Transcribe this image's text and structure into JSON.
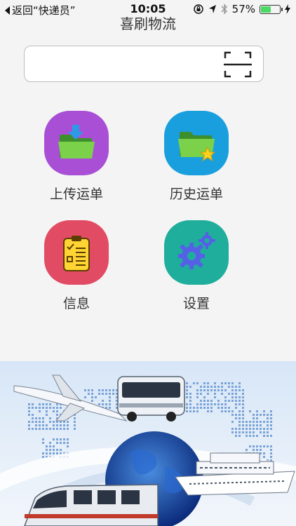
{
  "status_bar": {
    "back_label": "返回“快递员”",
    "time": "10:05",
    "battery_percent": "57%",
    "battery_level": 0.57
  },
  "header": {
    "title": "喜刷物流"
  },
  "search": {
    "value": "",
    "placeholder": "",
    "scan_icon": "scan-frame-icon"
  },
  "menu": {
    "items": [
      {
        "label": "上传运单",
        "icon": "upload-folder-icon",
        "color": "#a84fd6"
      },
      {
        "label": "历史运单",
        "icon": "folder-star-icon",
        "color": "#1a9fde"
      },
      {
        "label": "信息",
        "icon": "clipboard-checklist-icon",
        "color": "#e14b63"
      },
      {
        "label": "设置",
        "icon": "gears-icon",
        "color": "#1fae9c"
      }
    ]
  },
  "banner": {
    "icon": "logistics-banner-image"
  }
}
